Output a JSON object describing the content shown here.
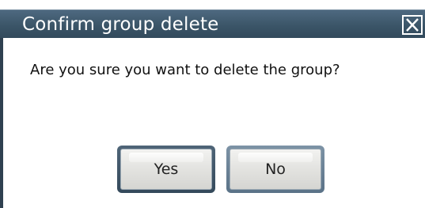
{
  "dialog": {
    "title": "Confirm group delete",
    "close_icon": "close-x-icon",
    "message": "Are you sure you want to delete the group?",
    "buttons": {
      "yes_label": "Yes",
      "no_label": "No"
    }
  },
  "colors": {
    "title_bar": "#3b5568",
    "title_text": "#ffffff",
    "button_face": "#e4e4e1",
    "button_frame": "#5a7287"
  }
}
